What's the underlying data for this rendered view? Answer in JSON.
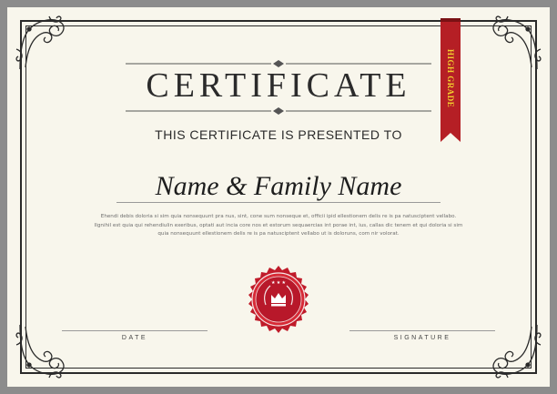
{
  "certificate": {
    "title": "CERTIFICATE",
    "subtitle": "THIS CERTIFICATE IS PRESENTED TO",
    "recipient_name": "Name & Family Name",
    "body_text": "Ehendi debis doloria si sim quia nonsequunt pra nus, sint, cone sum nonseque et, officii ipid ellestionem delis re is pa natusciptent vellabo. Ilgnihil est quia qui rehendiulin exeribus, optati aut incia core nos et estorum sequaercias int porae int, ius, callas dic tenem et qui doloria si sim quia nonsequunt ellestionem delis re is pa natusciptent vellabo ut is doloruns, com nir volorat.",
    "date_label": "DATE",
    "signature_label": "SIGNATURE",
    "ribbon_text": "HIGH GRADE",
    "colors": {
      "page_bg": "#f8f6ec",
      "border": "#2a2a2a",
      "seal_red": "#c01b2a",
      "ribbon_red": "#b51f25",
      "ribbon_text": "#f2cf2e"
    },
    "icons": {
      "seal": "crown-seal-icon",
      "corners": "flourish-corner-icon"
    }
  }
}
